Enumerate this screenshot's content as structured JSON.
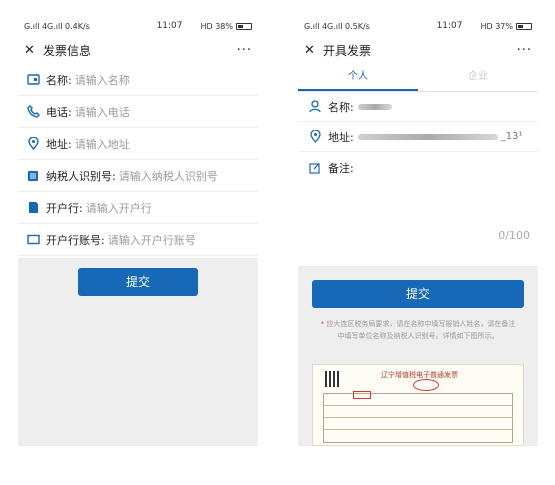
{
  "left": {
    "status": {
      "signal": "G.ıll 4G.ıll 0.4K/s",
      "time": "11:07",
      "right": "HD 38%"
    },
    "title": "发票信息",
    "more": "···",
    "fields": [
      {
        "label": "名称:",
        "placeholder": "请输入名称"
      },
      {
        "label": "电话:",
        "placeholder": "请输入电话"
      },
      {
        "label": "地址:",
        "placeholder": "请输入地址"
      },
      {
        "label": "纳税人识别号:",
        "placeholder": "请输入纳税人识别号"
      },
      {
        "label": "开户行:",
        "placeholder": "请输入开户行"
      },
      {
        "label": "开户行账号:",
        "placeholder": "请输入开户行账号"
      }
    ],
    "submit": "提交"
  },
  "right": {
    "status": {
      "signal": "G.ıll 4G.ıll 0.5K/s",
      "time": "11:07",
      "right": "HD 37%"
    },
    "title": "开具发票",
    "more": "···",
    "tabs": [
      "个人",
      "企业"
    ],
    "name_label": "名称:",
    "address_label": "地址:",
    "address_suffix": "_13¹",
    "note_label": "备注:",
    "counter": "0/100",
    "submit": "提交",
    "tip": "应大连区税务局要求，请在名称中填写报销人姓名，请在备注中填写单位名称及纳税人识别号。详情如下图所示。",
    "invoice_title": "辽宁增值税电子普通发票"
  },
  "colors": {
    "accent": "#1769b7",
    "background": "#eeeeee"
  }
}
